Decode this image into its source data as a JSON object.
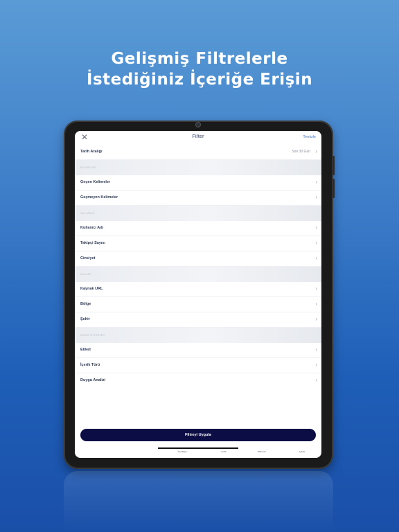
{
  "headline": {
    "line1": "Gelişmiş Filtrelerle",
    "line2": "İstediğiniz İçeriğe Erişin"
  },
  "screen": {
    "title": "Filter",
    "clear_label": "Temizle",
    "date_row": {
      "label": "Tarih Aralığı",
      "value": "Son 30 Gün"
    },
    "sections": [
      {
        "label": "KELİMELER",
        "items": [
          "Geçen Kelimeler",
          "Geçmeyen Kelimeler"
        ]
      },
      {
        "label": "KULLANICI",
        "items": [
          "Kullanıcı Adı",
          "Takipçi Sayısı",
          "Cinsiyet"
        ]
      },
      {
        "label": "KAYNAK",
        "items": [
          "Kaynak URL",
          "Bölge",
          "Şehir"
        ]
      },
      {
        "label": "DİĞER FİLTRELER",
        "items": [
          "Etiket",
          "İçerik Türü",
          "Duygu Analizi"
        ]
      }
    ],
    "apply_button": "Filtreyi Uygula",
    "tabs": [
      "Akış Bilgisi",
      "Grafik",
      "Bildirimler",
      "Ayarlar"
    ]
  }
}
